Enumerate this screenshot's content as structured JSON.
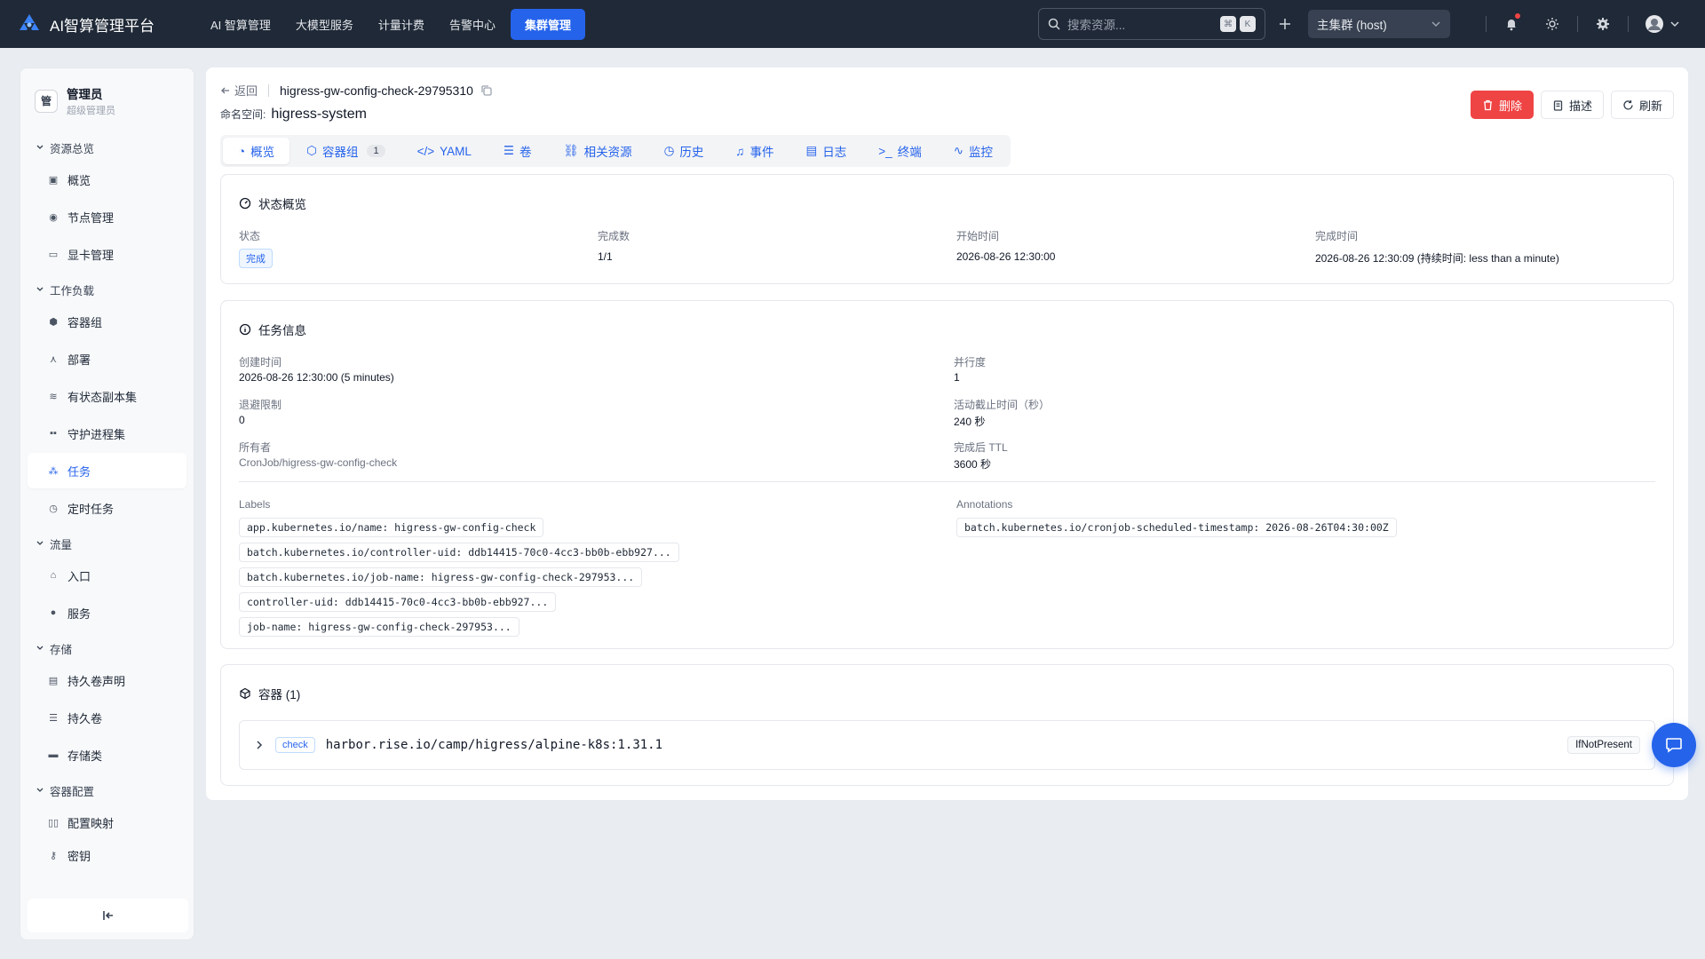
{
  "app": {
    "title": "AI智算管理平台"
  },
  "topnav": [
    {
      "label": "AI 智算管理",
      "active": false
    },
    {
      "label": "大模型服务",
      "active": false
    },
    {
      "label": "计量计费",
      "active": false
    },
    {
      "label": "告警中心",
      "active": false
    },
    {
      "label": "集群管理",
      "active": true
    }
  ],
  "search": {
    "placeholder": "搜索资源...",
    "kbd1": "⌘",
    "kbd2": "K"
  },
  "cluster": {
    "selected": "主集群 (host)"
  },
  "user": {
    "avatar": "管",
    "name": "管理员",
    "role": "超级管理员"
  },
  "sidebar": {
    "groups": [
      {
        "label": "资源总览",
        "items": [
          {
            "label": "概览"
          },
          {
            "label": "节点管理"
          },
          {
            "label": "显卡管理"
          }
        ]
      },
      {
        "label": "工作负载",
        "items": [
          {
            "label": "容器组"
          },
          {
            "label": "部署"
          },
          {
            "label": "有状态副本集"
          },
          {
            "label": "守护进程集"
          },
          {
            "label": "任务"
          },
          {
            "label": "定时任务"
          }
        ]
      },
      {
        "label": "流量",
        "items": [
          {
            "label": "入口"
          },
          {
            "label": "服务"
          }
        ]
      },
      {
        "label": "存储",
        "items": [
          {
            "label": "持久卷声明"
          },
          {
            "label": "持久卷"
          },
          {
            "label": "存储类"
          }
        ]
      },
      {
        "label": "容器配置",
        "items": [
          {
            "label": "配置映射"
          },
          {
            "label": "密钥"
          }
        ]
      }
    ]
  },
  "header": {
    "back": "返回",
    "name": "higress-gw-config-check-29795310",
    "ns_label": "命名空间:",
    "ns_value": "higress-system",
    "delete": "删除",
    "describe": "描述",
    "refresh": "刷新"
  },
  "tabs": {
    "overview": "概览",
    "pods": "容器组",
    "pods_count": "1",
    "yaml": "YAML",
    "volumes": "卷",
    "related": "相关资源",
    "history": "历史",
    "events": "事件",
    "logs": "日志",
    "terminal": "终端",
    "monitor": "监控"
  },
  "status_card": {
    "title": "状态概览",
    "status_label": "状态",
    "status_value": "完成",
    "completions_label": "完成数",
    "completions_value": "1/1",
    "start_label": "开始时间",
    "start_value": "2026-08-26 12:30:00",
    "finish_label": "完成时间",
    "finish_value": "2026-08-26 12:30:09 (持续时间: less than a minute)"
  },
  "job_card": {
    "title": "任务信息",
    "created_label": "创建时间",
    "created_value": "2026-08-26 12:30:00 (5 minutes)",
    "parallelism_label": "并行度",
    "parallelism_value": "1",
    "backoff_label": "退避限制",
    "backoff_value": "0",
    "deadline_label": "活动截止时间（秒）",
    "deadline_value": "240 秒",
    "owner_label": "所有者",
    "owner_value": "CronJob/higress-gw-config-check",
    "ttl_label": "完成后 TTL",
    "ttl_value": "3600 秒",
    "labels_title": "Labels",
    "labels": [
      "app.kubernetes.io/name: higress-gw-config-check",
      "batch.kubernetes.io/controller-uid: ddb14415-70c0-4cc3-bb0b-ebb927...",
      "batch.kubernetes.io/job-name: higress-gw-config-check-297953...",
      "controller-uid: ddb14415-70c0-4cc3-bb0b-ebb927...",
      "job-name: higress-gw-config-check-297953..."
    ],
    "annotations_title": "Annotations",
    "annotations": [
      "batch.kubernetes.io/cronjob-scheduled-timestamp: 2026-08-26T04:30:00Z"
    ]
  },
  "containers_card": {
    "title": "容器 (1)",
    "items": [
      {
        "name": "check",
        "image": "harbor.rise.io/camp/higress/alpine-k8s:1.31.1",
        "pull_policy": "IfNotPresent"
      }
    ]
  },
  "colors": {
    "primary": "#2563eb",
    "danger": "#ef4444",
    "topbar": "#1f2937"
  }
}
